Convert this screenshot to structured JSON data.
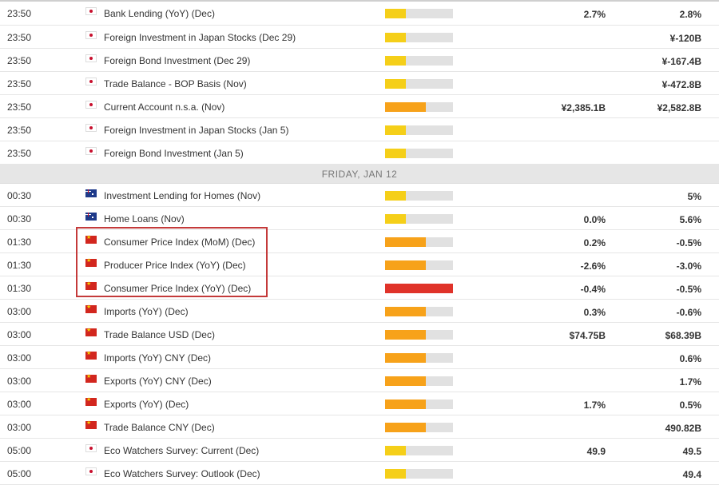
{
  "colors": {
    "low": "#f5cf19",
    "medium": "#f7a21a",
    "high": "#e0332a",
    "track": "#e1e1e1",
    "highlight": "#c43a3a"
  },
  "groups": [
    {
      "day_label": "",
      "rows": [
        {
          "time": "23:50",
          "flag": "japan-flag-icon",
          "event": "Bank Lending (YoY) (Dec)",
          "impact": "low",
          "impact_fraction": 0.3,
          "actual": "2.7%",
          "previous": "2.8%"
        },
        {
          "time": "23:50",
          "flag": "japan-flag-icon",
          "event": "Foreign Investment in Japan Stocks (Dec 29)",
          "impact": "low",
          "impact_fraction": 0.3,
          "actual": "",
          "previous": "¥-120B"
        },
        {
          "time": "23:50",
          "flag": "japan-flag-icon",
          "event": "Foreign Bond Investment (Dec 29)",
          "impact": "low",
          "impact_fraction": 0.3,
          "actual": "",
          "previous": "¥-167.4B"
        },
        {
          "time": "23:50",
          "flag": "japan-flag-icon",
          "event": "Trade Balance - BOP Basis (Nov)",
          "impact": "low",
          "impact_fraction": 0.3,
          "actual": "",
          "previous": "¥-472.8B"
        },
        {
          "time": "23:50",
          "flag": "japan-flag-icon",
          "event": "Current Account n.s.a. (Nov)",
          "impact": "medium",
          "impact_fraction": 0.6,
          "actual": "¥2,385.1B",
          "previous": "¥2,582.8B"
        },
        {
          "time": "23:50",
          "flag": "japan-flag-icon",
          "event": "Foreign Investment in Japan Stocks (Jan 5)",
          "impact": "low",
          "impact_fraction": 0.3,
          "actual": "",
          "previous": ""
        },
        {
          "time": "23:50",
          "flag": "japan-flag-icon",
          "event": "Foreign Bond Investment (Jan 5)",
          "impact": "low",
          "impact_fraction": 0.3,
          "actual": "",
          "previous": ""
        }
      ]
    },
    {
      "day_label": "FRIDAY, JAN 12",
      "rows": [
        {
          "time": "00:30",
          "flag": "australia-flag-icon",
          "event": "Investment Lending for Homes (Nov)",
          "impact": "low",
          "impact_fraction": 0.3,
          "actual": "",
          "previous": "5%"
        },
        {
          "time": "00:30",
          "flag": "australia-flag-icon",
          "event": "Home Loans (Nov)",
          "impact": "low",
          "impact_fraction": 0.3,
          "actual": "0.0%",
          "previous": "5.6%"
        },
        {
          "time": "01:30",
          "flag": "china-flag-icon",
          "event": "Consumer Price Index (MoM) (Dec)",
          "impact": "medium",
          "impact_fraction": 0.6,
          "actual": "0.2%",
          "previous": "-0.5%"
        },
        {
          "time": "01:30",
          "flag": "china-flag-icon",
          "event": "Producer Price Index (YoY) (Dec)",
          "impact": "medium",
          "impact_fraction": 0.6,
          "actual": "-2.6%",
          "previous": "-3.0%"
        },
        {
          "time": "01:30",
          "flag": "china-flag-icon",
          "event": "Consumer Price Index (YoY) (Dec)",
          "impact": "high",
          "impact_fraction": 1.0,
          "actual": "-0.4%",
          "previous": "-0.5%"
        },
        {
          "time": "03:00",
          "flag": "china-flag-icon",
          "event": "Imports (YoY) (Dec)",
          "impact": "medium",
          "impact_fraction": 0.6,
          "actual": "0.3%",
          "previous": "-0.6%"
        },
        {
          "time": "03:00",
          "flag": "china-flag-icon",
          "event": "Trade Balance USD (Dec)",
          "impact": "medium",
          "impact_fraction": 0.6,
          "actual": "$74.75B",
          "previous": "$68.39B"
        },
        {
          "time": "03:00",
          "flag": "china-flag-icon",
          "event": "Imports (YoY) CNY (Dec)",
          "impact": "medium",
          "impact_fraction": 0.6,
          "actual": "",
          "previous": "0.6%"
        },
        {
          "time": "03:00",
          "flag": "china-flag-icon",
          "event": "Exports (YoY) CNY (Dec)",
          "impact": "medium",
          "impact_fraction": 0.6,
          "actual": "",
          "previous": "1.7%"
        },
        {
          "time": "03:00",
          "flag": "china-flag-icon",
          "event": "Exports (YoY) (Dec)",
          "impact": "medium",
          "impact_fraction": 0.6,
          "actual": "1.7%",
          "previous": "0.5%"
        },
        {
          "time": "03:00",
          "flag": "china-flag-icon",
          "event": "Trade Balance CNY (Dec)",
          "impact": "medium",
          "impact_fraction": 0.6,
          "actual": "",
          "previous": "490.82B"
        },
        {
          "time": "05:00",
          "flag": "japan-flag-icon",
          "event": "Eco Watchers Survey: Current (Dec)",
          "impact": "low",
          "impact_fraction": 0.3,
          "actual": "49.9",
          "previous": "49.5"
        },
        {
          "time": "05:00",
          "flag": "japan-flag-icon",
          "event": "Eco Watchers Survey: Outlook (Dec)",
          "impact": "low",
          "impact_fraction": 0.3,
          "actual": "",
          "previous": "49.4"
        }
      ]
    }
  ]
}
